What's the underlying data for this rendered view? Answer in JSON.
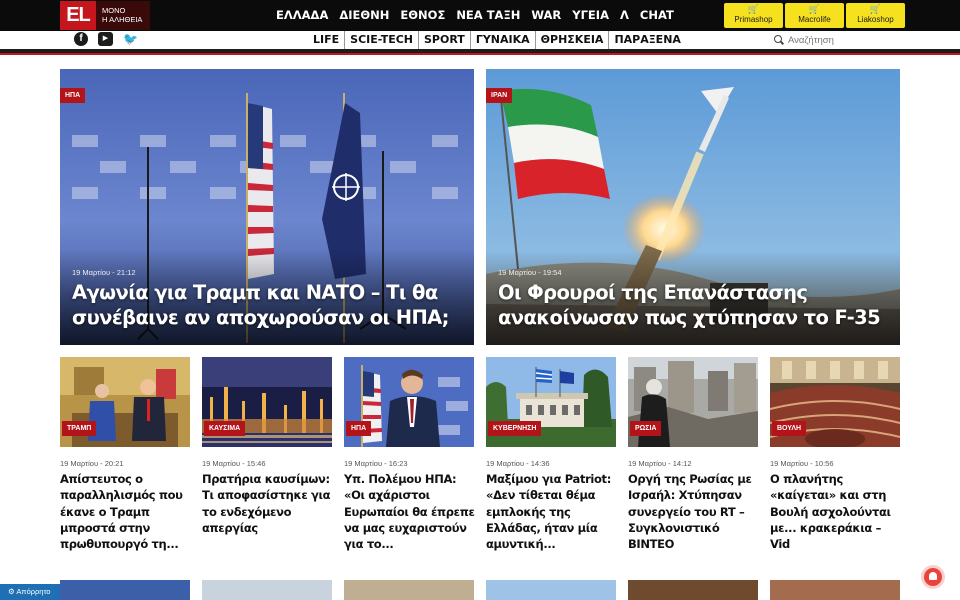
{
  "brand": {
    "logo_text": "EL",
    "tagline_line1": "ΜΟΝΟ",
    "tagline_line2": "Η ΑΛΗΘΕΙΑ",
    "accent": "#c4161c",
    "shop_color": "#f5e11e"
  },
  "main_nav": [
    "ΕΛΛΑΔΑ",
    "ΔΙΕΘΝΗ",
    "ΕΘΝΟΣ",
    "ΝΕΑ ΤΑΞΗ",
    "WAR",
    "ΥΓΕΙΑ",
    "Λ",
    "CHAT"
  ],
  "shops": [
    {
      "label": "Primashop",
      "icon": "cart-icon"
    },
    {
      "label": "Macrolife",
      "icon": "cart-icon"
    },
    {
      "label": "Liakoshop",
      "icon": "cart-icon"
    }
  ],
  "social": [
    {
      "icon": "facebook-icon",
      "glyph": "f"
    },
    {
      "icon": "youtube-icon",
      "glyph": "▶"
    },
    {
      "icon": "twitter-icon",
      "glyph": "🐦"
    }
  ],
  "sub_nav": [
    "LIFE",
    "SCIE-TECH",
    "SPORT",
    "ΓΥΝΑΙΚΑ",
    "ΘΡΗΣΚΕΙΑ",
    "ΠΑΡΑΞΕΝΑ"
  ],
  "search": {
    "placeholder": "Αναζήτηση"
  },
  "featured": [
    {
      "category": "ΗΠΑ",
      "time": "19 Μαρτίου - 21:12",
      "title": "Αγωνία για Τραμπ και ΝΑΤΟ – Τι θα συνέβαινε αν αποχωρούσαν οι ΗΠΑ;"
    },
    {
      "category": "ΙΡΑΝ",
      "time": "19 Μαρτίου - 19:54",
      "title": "Οι Φρουροί της Επανάστασης ανακοίνωσαν πως χτύπησαν το F-35"
    }
  ],
  "articles": [
    {
      "category": "ΤΡΑΜΠ",
      "time": "19 Μαρτίου - 20:21",
      "title": "Απίστευτος ο παραλληλισμός που έκανε ο Τραμπ μπροστά στην πρωθυπουργό τη..."
    },
    {
      "category": "ΚΑΥΣΙΜΑ",
      "time": "19 Μαρτίου - 15:46",
      "title": "Πρατήρια καυσίμων: Τι αποφασίστηκε για το ενδεχόμενο απεργίας"
    },
    {
      "category": "ΗΠΑ",
      "time": "19 Μαρτίου - 16:23",
      "title": "Υπ. Πολέμου ΗΠΑ: «Οι αχάριστοι Ευρωπαίοι θα έπρεπε να μας ευχαριστούν για το..."
    },
    {
      "category": "ΚΥΒΕΡΝΗΣΗ",
      "time": "19 Μαρτίου - 14:36",
      "title": "Μαξίμου για Patriot: «Δεν τίθεται θέμα εμπλοκής της Ελλάδας, ήταν μία αμυντική..."
    },
    {
      "category": "ΡΩΣΙΑ",
      "time": "19 Μαρτίου - 14:12",
      "title": "Οργή της Ρωσίας με Ισραήλ: Χτύπησαν συνεργείο του RT – Συγκλονιστικό ΒΙΝΤΕΟ"
    },
    {
      "category": "ΒΟΥΛΗ",
      "time": "19 Μαρτίου - 10:56",
      "title": "Ο πλανήτης «καίγεται» και στη Βουλή ασχολούνται με... κρακεράκια – Vid"
    }
  ],
  "accessibility": {
    "label": "⚙ Απόρρητο"
  }
}
